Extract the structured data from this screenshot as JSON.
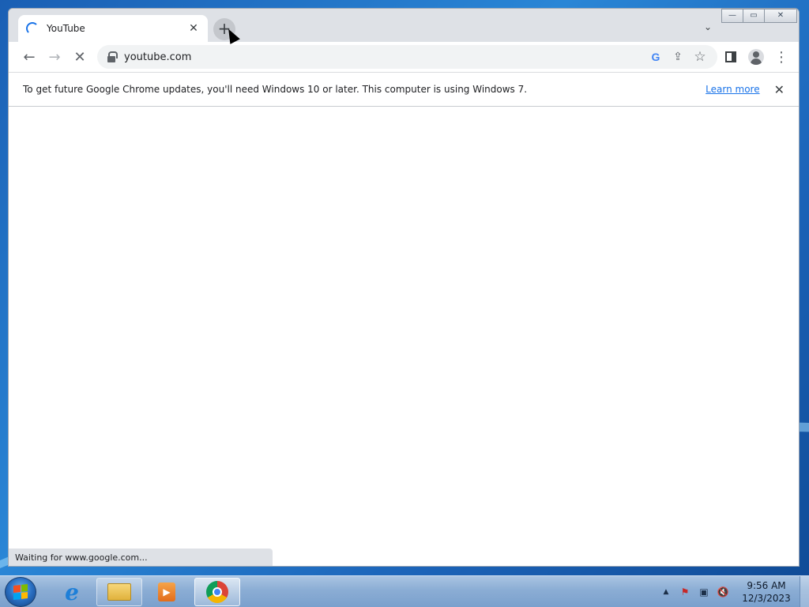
{
  "browser": {
    "tab": {
      "title": "YouTube",
      "close_glyph": "✕"
    },
    "new_tab_glyph": "+",
    "tab_search_glyph": "⌄",
    "window_controls": {
      "minimize": "—",
      "restore": "▭",
      "close": "✕"
    },
    "toolbar": {
      "back_glyph": "←",
      "forward_glyph": "→",
      "stop_glyph": "✕",
      "url": "youtube.com",
      "google_glyph": "G",
      "share_glyph": "⇪",
      "bookmark_glyph": "☆",
      "menu_glyph": "⋮"
    },
    "infobar": {
      "message": "To get future Google Chrome updates, you'll need Windows 10 or later. This computer is using Windows 7.",
      "link": "Learn more",
      "close_glyph": "✕"
    },
    "status": "Waiting for www.google.com..."
  },
  "taskbar": {
    "apps": [
      {
        "name": "internet-explorer-icon",
        "glyph": "e"
      },
      {
        "name": "windows-explorer-icon",
        "glyph": ""
      },
      {
        "name": "media-player-icon",
        "glyph": "▶"
      },
      {
        "name": "chrome-icon",
        "glyph": ""
      }
    ],
    "tray": {
      "show_hidden_glyph": "▲",
      "flag_glyph": "⚑",
      "network_glyph": "▣",
      "volume_glyph": "🔇"
    },
    "clock": {
      "time": "9:56 AM",
      "date": "12/3/2023"
    }
  },
  "colors": {
    "accent": "#1a73e8",
    "tabstrip": "#dee1e6",
    "taskbar": "#8badd4"
  }
}
